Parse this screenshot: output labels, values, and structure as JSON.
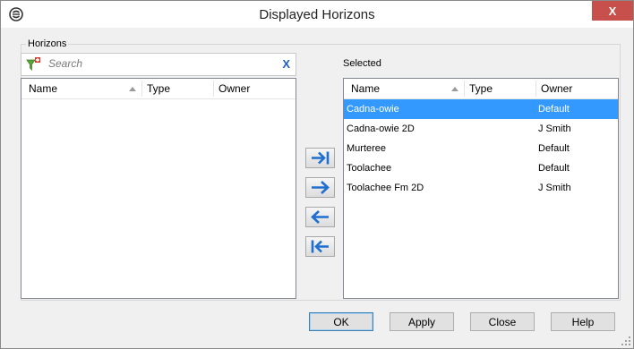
{
  "window": {
    "title": "Displayed Horizons",
    "close_symbol": "X"
  },
  "horizons_group": {
    "label": "Horizons",
    "search": {
      "placeholder": "Search",
      "value": "",
      "clear_symbol": "X"
    },
    "columns": [
      "Name",
      "Type",
      "Owner"
    ],
    "rows": []
  },
  "selected_group": {
    "label": "Selected",
    "columns": [
      "Name",
      "Type",
      "Owner"
    ],
    "rows": [
      {
        "name": "Cadna-owie",
        "type": "",
        "owner": "Default"
      },
      {
        "name": "Cadna-owie 2D",
        "type": "",
        "owner": "J Smith"
      },
      {
        "name": "Murteree",
        "type": "",
        "owner": "Default"
      },
      {
        "name": "Toolachee",
        "type": "",
        "owner": "Default"
      },
      {
        "name": "Toolachee Fm 2D",
        "type": "",
        "owner": "J Smith"
      }
    ],
    "selected_index": 0
  },
  "transfer_buttons": [
    "move-all-right-icon",
    "move-right-icon",
    "move-left-icon",
    "move-all-left-icon"
  ],
  "buttons": {
    "ok": "OK",
    "apply": "Apply",
    "close": "Close",
    "help": "Help"
  },
  "colors": {
    "selection": "#3399ff",
    "close_button": "#c7504c",
    "arrow": "#1f6fd0"
  }
}
